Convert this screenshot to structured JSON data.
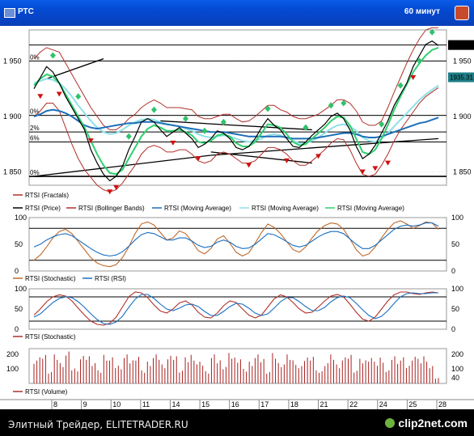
{
  "window": {
    "title": "РТС",
    "period": "60 минут"
  },
  "footer": {
    "watermark": "Элитный Трейдер, ELITETRADER.RU",
    "logo": "clip2net.com"
  },
  "colors": {
    "price": "#000000",
    "bollinger": "#b0302a",
    "ma1": "#1c6fb8",
    "ma2": "#8fe0e8",
    "ma3": "#2fcf6f",
    "fractal_up": "#2ec36a",
    "fractal_down": "#d01010",
    "stoch": "#c06a2a",
    "rsi": "#1a6fc0",
    "volume": "#a82020"
  },
  "chart_data": [
    {
      "type": "line",
      "title": "",
      "ylim": [
        1838,
        1978
      ],
      "y_ticks": [
        1850,
        1900,
        1950
      ],
      "y_tick_labels": [
        "1 850",
        "1 900",
        "1 950"
      ],
      "hlines": [
        1846,
        1877,
        1886,
        1901,
        1950,
        1964.4
      ],
      "fib_labels": [
        {
          "label": "0%",
          "value": 1950
        },
        {
          "label": "0%",
          "value": 1901
        },
        {
          "label": "2%",
          "value": 1886
        },
        {
          "label": "6%",
          "value": 1877
        },
        {
          "label": "0%",
          "value": 1846
        }
      ],
      "price_tags": [
        {
          "label": "1964.40",
          "value": 1964.4,
          "color": "#000000"
        },
        {
          "label": "1935.31",
          "value": 1935.31,
          "color": "#1e7d86"
        }
      ],
      "price": [
        1925,
        1935,
        1945,
        1940,
        1930,
        1918,
        1908,
        1898,
        1888,
        1870,
        1858,
        1848,
        1842,
        1846,
        1855,
        1870,
        1882,
        1895,
        1898,
        1895,
        1888,
        1882,
        1886,
        1890,
        1885,
        1880,
        1872,
        1875,
        1880,
        1887,
        1885,
        1880,
        1872,
        1870,
        1873,
        1880,
        1890,
        1898,
        1892,
        1888,
        1880,
        1873,
        1872,
        1877,
        1883,
        1888,
        1893,
        1900,
        1903,
        1898,
        1888,
        1873,
        1862,
        1866,
        1874,
        1885,
        1896,
        1910,
        1920,
        1930,
        1945,
        1955,
        1965,
        1968,
        1964
      ],
      "bollinger_upper": [
        1952,
        1958,
        1962,
        1960,
        1958,
        1948,
        1938,
        1928,
        1918,
        1908,
        1900,
        1892,
        1888,
        1888,
        1892,
        1898,
        1902,
        1908,
        1912,
        1915,
        1912,
        1908,
        1908,
        1908,
        1907,
        1906,
        1900,
        1898,
        1898,
        1900,
        1902,
        1902,
        1898,
        1895,
        1896,
        1900,
        1905,
        1910,
        1910,
        1906,
        1904,
        1900,
        1898,
        1898,
        1900,
        1902,
        1906,
        1910,
        1915,
        1915,
        1912,
        1905,
        1895,
        1892,
        1892,
        1896,
        1908,
        1922,
        1935,
        1948,
        1960,
        1970,
        1978,
        1980,
        1980
      ],
      "bollinger_lower": [
        1900,
        1905,
        1912,
        1912,
        1905,
        1890,
        1875,
        1862,
        1852,
        1845,
        1838,
        1834,
        1832,
        1834,
        1840,
        1848,
        1856,
        1866,
        1872,
        1874,
        1872,
        1868,
        1868,
        1870,
        1870,
        1866,
        1860,
        1858,
        1860,
        1866,
        1868,
        1866,
        1862,
        1858,
        1858,
        1860,
        1866,
        1872,
        1872,
        1870,
        1866,
        1860,
        1856,
        1856,
        1860,
        1865,
        1870,
        1876,
        1880,
        1879,
        1870,
        1858,
        1848,
        1846,
        1848,
        1856,
        1866,
        1878,
        1888,
        1896,
        1904,
        1912,
        1918,
        1922,
        1926
      ],
      "ma_blue": [
        1900,
        1902,
        1905,
        1906,
        1905,
        1903,
        1900,
        1896,
        1892,
        1890,
        1889,
        1890,
        1891,
        1892,
        1893,
        1894,
        1894,
        1895,
        1895,
        1895,
        1894,
        1893,
        1892,
        1891,
        1890,
        1889,
        1888,
        1887,
        1886,
        1886,
        1886,
        1885,
        1884,
        1883,
        1882,
        1882,
        1882,
        1882,
        1882,
        1882,
        1881,
        1880,
        1880,
        1880,
        1880,
        1881,
        1882,
        1883,
        1884,
        1885,
        1885,
        1884,
        1882,
        1881,
        1881,
        1882,
        1884,
        1886,
        1888,
        1890,
        1892,
        1894,
        1895,
        1897,
        1899
      ],
      "ma_cyan": [
        1930,
        1932,
        1934,
        1933,
        1930,
        1925,
        1918,
        1910,
        1903,
        1896,
        1890,
        1886,
        1884,
        1885,
        1888,
        1892,
        1895,
        1897,
        1898,
        1897,
        1895,
        1893,
        1892,
        1891,
        1889,
        1887,
        1884,
        1882,
        1881,
        1882,
        1883,
        1882,
        1880,
        1878,
        1877,
        1878,
        1880,
        1883,
        1884,
        1883,
        1881,
        1878,
        1876,
        1876,
        1878,
        1881,
        1885,
        1889,
        1892,
        1893,
        1891,
        1887,
        1881,
        1878,
        1877,
        1880,
        1885,
        1891,
        1897,
        1903,
        1909,
        1915,
        1920,
        1924,
        1928
      ],
      "ma_green": [
        1928,
        1934,
        1938,
        1936,
        1930,
        1920,
        1910,
        1900,
        1890,
        1878,
        1866,
        1856,
        1849,
        1848,
        1852,
        1862,
        1872,
        1882,
        1889,
        1892,
        1890,
        1887,
        1887,
        1888,
        1886,
        1883,
        1877,
        1876,
        1878,
        1883,
        1884,
        1882,
        1876,
        1873,
        1873,
        1877,
        1885,
        1893,
        1892,
        1890,
        1884,
        1877,
        1874,
        1875,
        1880,
        1885,
        1890,
        1896,
        1900,
        1899,
        1892,
        1880,
        1868,
        1866,
        1870,
        1880,
        1892,
        1906,
        1918,
        1929,
        1940,
        1948,
        1955,
        1960,
        1962
      ],
      "fractal_up": [
        [
          3,
          1955
        ],
        [
          7,
          1918
        ],
        [
          15,
          1882
        ],
        [
          19,
          1906
        ],
        [
          24,
          1898
        ],
        [
          27,
          1887
        ],
        [
          30,
          1895
        ],
        [
          37,
          1907
        ],
        [
          43,
          1890
        ],
        [
          47,
          1910
        ],
        [
          49,
          1912
        ],
        [
          55,
          1893
        ],
        [
          58,
          1928
        ],
        [
          61,
          1950
        ],
        [
          63,
          1976
        ]
      ],
      "fractal_down": [
        [
          1,
          1918
        ],
        [
          4,
          1920
        ],
        [
          9,
          1878
        ],
        [
          12,
          1832
        ],
        [
          13,
          1836
        ],
        [
          22,
          1876
        ],
        [
          26,
          1862
        ],
        [
          34,
          1856
        ],
        [
          40,
          1860
        ],
        [
          45,
          1864
        ],
        [
          52,
          1850
        ],
        [
          54,
          1853
        ],
        [
          56,
          1858
        ],
        [
          60,
          1935
        ]
      ]
    },
    {
      "type": "line",
      "ylim": [
        0,
        100
      ],
      "y_ticks": [
        0,
        50,
        100
      ],
      "hlines": [
        20,
        80
      ],
      "series": [
        {
          "name": "RTSI (Stochastic)",
          "values": [
            20,
            30,
            45,
            62,
            74,
            78,
            70,
            55,
            40,
            25,
            15,
            10,
            8,
            12,
            25,
            45,
            70,
            88,
            92,
            86,
            72,
            58,
            62,
            75,
            70,
            55,
            38,
            32,
            42,
            60,
            66,
            52,
            35,
            28,
            34,
            52,
            72,
            88,
            82,
            70,
            55,
            40,
            35,
            45,
            62,
            76,
            85,
            90,
            88,
            78,
            60,
            40,
            28,
            32,
            45,
            62,
            78,
            90,
            94,
            88,
            80,
            85,
            92,
            90,
            78
          ]
        },
        {
          "name": "RTSI (RSI)",
          "values": [
            45,
            50,
            58,
            64,
            68,
            70,
            66,
            58,
            50,
            42,
            35,
            30,
            28,
            30,
            36,
            46,
            58,
            68,
            72,
            70,
            64,
            58,
            58,
            62,
            62,
            56,
            48,
            44,
            46,
            54,
            58,
            54,
            46,
            42,
            43,
            50,
            60,
            70,
            68,
            62,
            55,
            48,
            45,
            48,
            56,
            64,
            70,
            74,
            74,
            70,
            60,
            50,
            42,
            42,
            48,
            58,
            68,
            78,
            84,
            86,
            84,
            86,
            90,
            90,
            84
          ]
        }
      ]
    },
    {
      "type": "line",
      "ylim": [
        0,
        100
      ],
      "y_ticks": [
        0,
        50,
        100
      ],
      "hlines": [
        20,
        80
      ],
      "series": [
        {
          "name": "RTSI (Stochastic)",
          "values": [
            35,
            50,
            68,
            80,
            85,
            82,
            70,
            52,
            35,
            20,
            12,
            10,
            15,
            30,
            55,
            80,
            92,
            90,
            78,
            60,
            45,
            40,
            50,
            65,
            70,
            60,
            42,
            30,
            28,
            40,
            58,
            70,
            66,
            50,
            35,
            28,
            35,
            55,
            75,
            85,
            80,
            66,
            50,
            40,
            42,
            55,
            70,
            82,
            86,
            80,
            62,
            42,
            25,
            20,
            30,
            50,
            70,
            85,
            92,
            92,
            88,
            86,
            90,
            92,
            90
          ]
        },
        {
          "name": "RTSI (Stochastic) %D",
          "values": [
            30,
            38,
            52,
            66,
            76,
            80,
            78,
            68,
            54,
            38,
            24,
            14,
            12,
            18,
            32,
            54,
            74,
            86,
            86,
            76,
            62,
            50,
            46,
            52,
            60,
            62,
            56,
            44,
            34,
            34,
            44,
            56,
            64,
            62,
            52,
            40,
            34,
            38,
            52,
            68,
            78,
            78,
            68,
            56,
            46,
            46,
            54,
            68,
            78,
            82,
            78,
            64,
            48,
            34,
            26,
            32,
            46,
            64,
            80,
            88,
            90,
            88,
            88,
            90,
            90
          ]
        }
      ]
    },
    {
      "type": "bar",
      "ylim": [
        0,
        240
      ],
      "y_ticks": [
        100,
        200
      ],
      "y_tick_labels": [
        "100",
        "200"
      ],
      "right_tick_labels": [
        "200",
        "100",
        "40"
      ],
      "last_value": 40,
      "series": [
        {
          "name": "RTSI (Volume)",
          "values": [
            180,
            210,
            90,
            200,
            150,
            220,
            110,
            190,
            200,
            160,
            90,
            210,
            180,
            130,
            200,
            170,
            210,
            90,
            160,
            200,
            140,
            190,
            200,
            100,
            180,
            210,
            150,
            90,
            200,
            170,
            130,
            210,
            190,
            100,
            160,
            200,
            180,
            90,
            210,
            150,
            200,
            170,
            120,
            190,
            210,
            90,
            160,
            200,
            140,
            180,
            210,
            100,
            170,
            200,
            150,
            190,
            90,
            200,
            180,
            130,
            210,
            170,
            200,
            120,
            40
          ]
        }
      ],
      "bar_count": 140
    }
  ],
  "x_axis": {
    "labels": [
      "8",
      "9",
      "10",
      "11",
      "14",
      "15",
      "16",
      "17",
      "18",
      "21",
      "22",
      "24",
      "25",
      "28"
    ]
  },
  "legends": {
    "panel1": [
      {
        "text": "RTSI (Fractals)",
        "color": "#b0302a"
      },
      {
        "text": "RTSI (Price)",
        "color": "#000000"
      },
      {
        "text": "RTSI (Bollinger Bands)",
        "color": "#b0302a"
      },
      {
        "text": "RTSI (Moving Average)",
        "color": "#1c6fb8"
      },
      {
        "text": "RTSI (Moving Average)",
        "color": "#8fe0e8"
      },
      {
        "text": "RTSI (Moving Average)",
        "color": "#2fcf6f"
      }
    ],
    "panel2": [
      {
        "text": "RTSI (Stochastic)",
        "color": "#c06a2a"
      },
      {
        "text": "RTSI (RSI)",
        "color": "#1a6fc0"
      }
    ],
    "panel3": [
      {
        "text": "RTSI (Stochastic)",
        "color": "#b0302a"
      }
    ],
    "panel4": [
      {
        "text": "RTSI (Volume)",
        "color": "#b0302a"
      }
    ]
  }
}
